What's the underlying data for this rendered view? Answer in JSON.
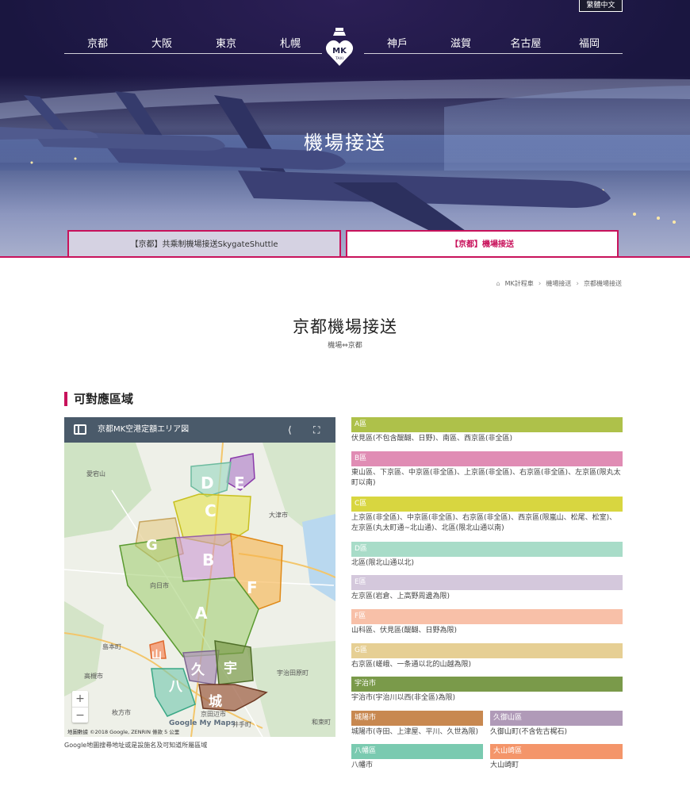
{
  "lang_button": "繁體中文",
  "nav": {
    "left": [
      "京都",
      "大阪",
      "東京",
      "札幌"
    ],
    "right": [
      "神戶",
      "滋賀",
      "名古屋",
      "福岡"
    ],
    "logo_text": "MK",
    "logo_sub": "TAXI"
  },
  "hero": {
    "title": "機場接送",
    "tabs": [
      {
        "label": "【京都】共乘制機場接送SkygateShuttle",
        "active": false
      },
      {
        "label": "【京都】機場接送",
        "active": true
      }
    ]
  },
  "breadcrumb": [
    "MK計程車",
    "機場接送",
    "京都機場接送"
  ],
  "page": {
    "title": "京都機場接送",
    "subtitle": "機場⇔京都"
  },
  "section": {
    "title": "可對應區域"
  },
  "map": {
    "bar_title": "京都MK空港定額エリア図",
    "labels": [
      "A",
      "B",
      "C",
      "D",
      "E",
      "F",
      "G",
      "宇",
      "八",
      "城",
      "久",
      "山"
    ],
    "places": [
      "愛宕山",
      "大津市",
      "向日市",
      "高槻市",
      "枚方市",
      "京田辺市",
      "宇治田原町",
      "島本町",
      "和束町",
      "井手町"
    ],
    "attribution": "地圖數據 ©2018 Google, ZENRIN   條款   5 公里",
    "google": "Google My Maps",
    "zoom_in": "+",
    "zoom_out": "−",
    "note": "Google地圖搜尋地址或是設施名及可知道所屬區域"
  },
  "areas": [
    {
      "name": "A區",
      "color": "#aec14a",
      "desc": "伏見區(不包含醍醐、日野)、南區、西京區(非全區)"
    },
    {
      "name": "B區",
      "color": "#e08cb4",
      "desc": "東山區、下京區、中京區(非全區)、上京區(非全區)、右京區(非全區)、左京區(限丸太町以南)"
    },
    {
      "name": "C區",
      "color": "#d8d640",
      "desc": "上京區(非全區)、中京區(非全區)、右京區(非全區)、西京區(限嵐山、松尾、松室)、左京區(丸太町通~北山通)、北區(限北山通以南)"
    },
    {
      "name": "D區",
      "color": "#a8dcc8",
      "desc": "北區(限北山通以北)"
    },
    {
      "name": "E區",
      "color": "#d4c8dc",
      "desc": "左京區(岩倉、上高野周邊為限)"
    },
    {
      "name": "F區",
      "color": "#f8c0a8",
      "desc": "山科區、伏見區(醍醐、日野為限)"
    },
    {
      "name": "G區",
      "color": "#e6cf94",
      "desc": "右京區(嵯峨、一条通以北的山越為限)"
    },
    {
      "name": "宇治市",
      "color": "#7a9a4a",
      "desc": "宇治市(宇治川以西(非全區)為限)"
    },
    {
      "name": "城陽市",
      "color": "#c88850",
      "desc": "城陽市(寺田、上津屋、平川、久世為限)"
    },
    {
      "name": "久御山區",
      "color": "#b09ab8",
      "desc": "久御山町(不含佐古梶石)"
    },
    {
      "name": "八幡區",
      "color": "#7acab0",
      "desc": "八幡市"
    },
    {
      "name": "大山崎區",
      "color": "#f4956a",
      "desc": "大山崎町"
    }
  ]
}
